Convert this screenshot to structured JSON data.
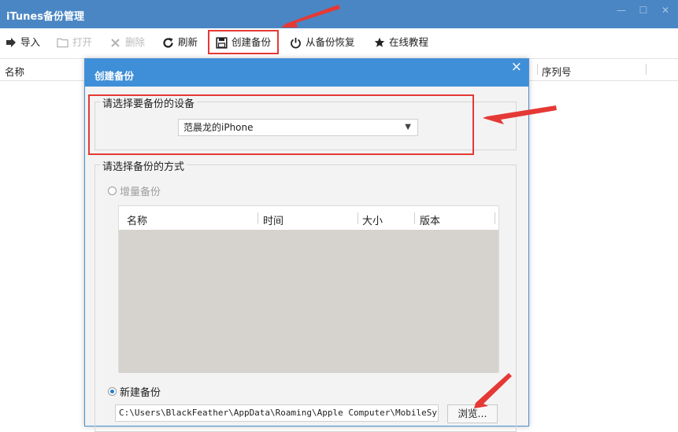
{
  "window": {
    "title": "iTunes备份管理"
  },
  "toolbar": {
    "import": "导入",
    "open": "打开",
    "delete": "删除",
    "refresh": "刷新",
    "create_backup": "创建备份",
    "restore": "从备份恢复",
    "tutorial": "在线教程"
  },
  "list": {
    "col_name": "名称",
    "col_serial": "序列号"
  },
  "dialog": {
    "title": "创建备份",
    "device_group_label": "请选择要备份的设备",
    "device_selected": "范晨龙的iPhone",
    "method_group_label": "请选择备份的方式",
    "incremental_label": "增量备份",
    "table_headers": [
      "名称",
      "时间",
      "大小",
      "版本"
    ],
    "new_backup_label": "新建备份",
    "path_value": "C:\\Users\\BlackFeather\\AppData\\Roaming\\Apple Computer\\MobileSync\\Backup",
    "browse_label": "浏览..."
  },
  "colors": {
    "titlebar": "#4a86c4",
    "dialog_title": "#3f8fd8",
    "annotation": "#e53935"
  }
}
